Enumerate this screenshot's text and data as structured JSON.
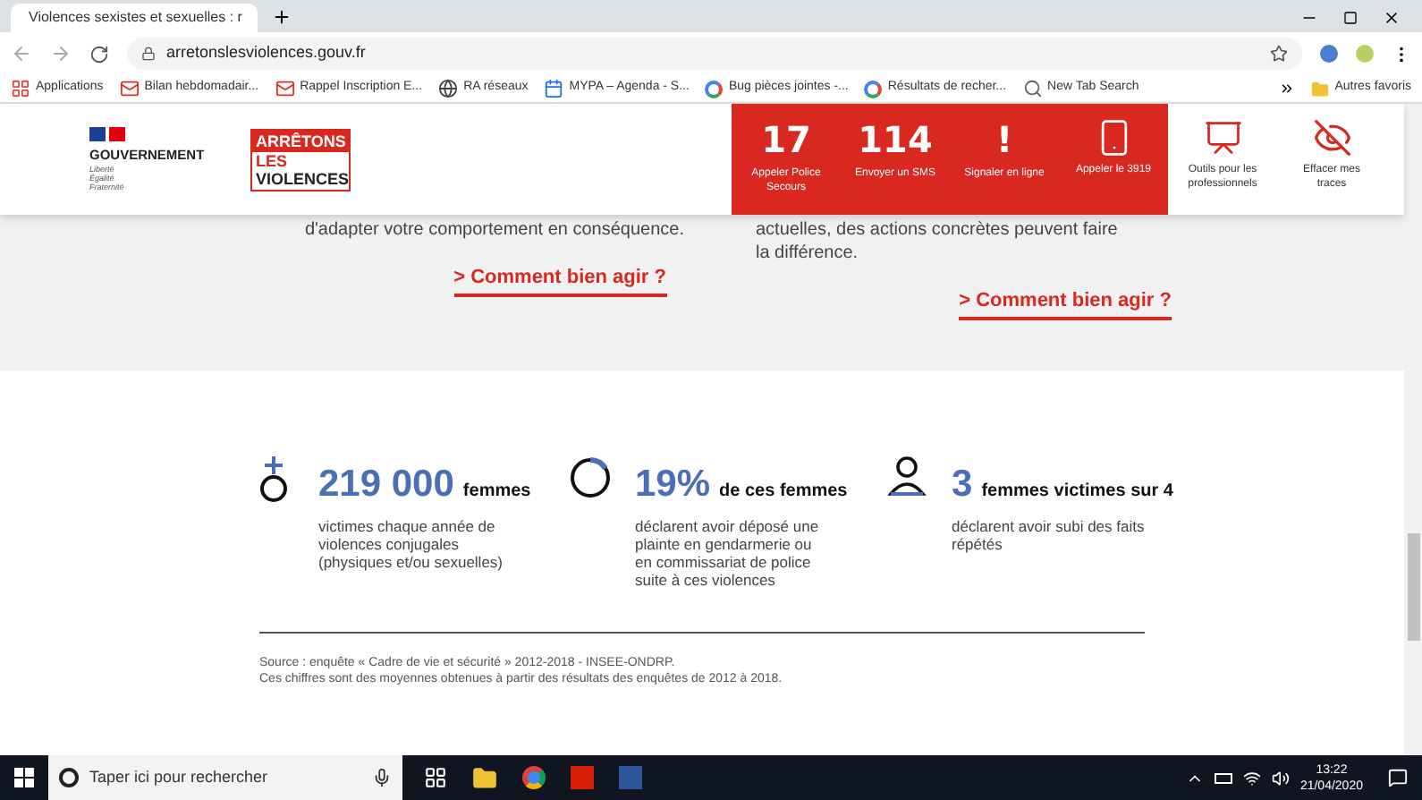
{
  "browser": {
    "tab": {
      "title": "Violences sexistes et sexuelles : r"
    },
    "address": "arretonslesviolences.gouv.fr",
    "bookmarks": [
      {
        "label": "Applications",
        "kind": "apps"
      },
      {
        "label": "Bilan hebdomadair...",
        "kind": "gmail"
      },
      {
        "label": "Rappel Inscription E...",
        "kind": "gmail"
      },
      {
        "label": "RA réseaux",
        "kind": "globe"
      },
      {
        "label": "MYPA – Agenda - S...",
        "kind": "calendar"
      },
      {
        "label": "Bug pièces jointes -...",
        "kind": "google"
      },
      {
        "label": "Résultats de recher...",
        "kind": "google"
      },
      {
        "label": "New Tab Search",
        "kind": "search"
      }
    ],
    "other_bookmarks": "Autres favoris"
  },
  "header": {
    "gov": {
      "name": "GOUVERNEMENT",
      "motto": [
        "Liberté",
        "Égalité",
        "Fraternité"
      ]
    },
    "logo": [
      "ARRÊTONS",
      "LES",
      "VIOLENCES"
    ],
    "actions": [
      {
        "kind": "number",
        "big": "17",
        "label": "Appeler Police Secours"
      },
      {
        "kind": "number",
        "big": "114",
        "label": "Envoyer un SMS"
      },
      {
        "kind": "alert",
        "big": "!",
        "label": "Signaler en ligne"
      },
      {
        "kind": "phone",
        "label": "Appeler le 3919"
      },
      {
        "kind": "tools",
        "label": "Outils pour les professionnels"
      },
      {
        "kind": "eye",
        "label": "Effacer mes traces"
      }
    ]
  },
  "intro": {
    "columns": [
      {
        "text": "d'adapter votre comportement en conséquence.",
        "link": "> Comment bien agir ?"
      },
      {
        "text": "actuelles, des actions concrètes peuvent faire la différence.",
        "link": "> Comment bien agir ?"
      }
    ]
  },
  "stats": [
    {
      "kind": "venus",
      "figure": "219 000",
      "unit": "femmes",
      "text": "victimes chaque année de violences conjugales (physiques et/ou sexuelles)"
    },
    {
      "kind": "ring",
      "figure": "19%",
      "unit": "de ces femmes",
      "text": "déclarent avoir déposé une plainte en gendarmerie ou en commissariat de police suite à ces violences"
    },
    {
      "kind": "person",
      "figure": "3",
      "unit": "femmes victimes sur 4",
      "text": "déclarent avoir subi des faits répétés"
    }
  ],
  "source": [
    "Source : enquête « Cadre de vie et sécurité » 2012-2018 - INSEE-ONDRP.",
    "Ces chiffres sont des moyennes obtenues à partir des résultats des enquêtes de 2012 à 2018."
  ],
  "taskbar": {
    "search_placeholder": "Taper ici pour rechercher",
    "time": "13:22",
    "date": "21/04/2020"
  }
}
